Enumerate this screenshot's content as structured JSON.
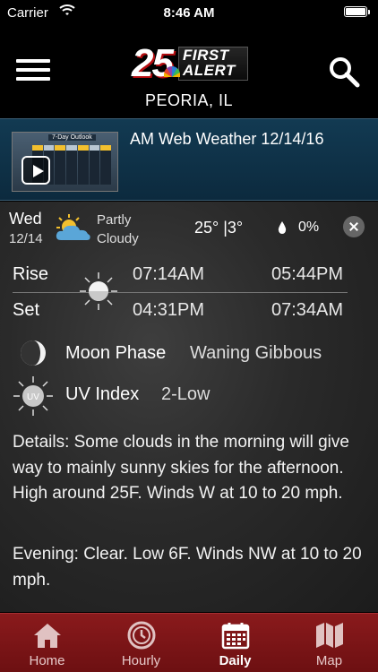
{
  "status_bar": {
    "carrier": "Carrier",
    "time": "8:46 AM"
  },
  "header": {
    "logo": {
      "number": "25",
      "line1": "FIRST",
      "line2": "ALERT"
    },
    "location": "PEORIA, IL"
  },
  "video": {
    "title": "AM Web Weather 12/14/16",
    "thumbnail_caption": "7-Day Outlook"
  },
  "day": {
    "name": "Wed",
    "date": "12/14",
    "condition_line1": "Partly",
    "condition_line2": "Cloudy",
    "temps": "25° |3°",
    "precip": "0%",
    "icon": "partly-cloudy-icon"
  },
  "sun_moon": {
    "rise_label": "Rise",
    "set_label": "Set",
    "sunrise": "07:14AM",
    "sunset": "04:31PM",
    "moonrise": "05:44PM",
    "moonset": "07:34AM"
  },
  "moon_phase": {
    "label": "Moon Phase",
    "value": "Waning Gibbous"
  },
  "uv": {
    "label": "UV Index",
    "value": "2-Low",
    "icon_text": "UV"
  },
  "details": "Details: Some clouds in the morning will give way to mainly sunny skies for the afternoon. High around 25F. Winds W at 10 to 20 mph.",
  "evening": "Evening: Clear. Low 6F. Winds NW at 10 to 20 mph.",
  "tabs": [
    {
      "label": "Home",
      "icon": "home-icon",
      "active": false
    },
    {
      "label": "Hourly",
      "icon": "clock-icon",
      "active": false
    },
    {
      "label": "Daily",
      "icon": "calendar-icon",
      "active": true
    },
    {
      "label": "Map",
      "icon": "map-icon",
      "active": false
    }
  ],
  "colors": {
    "tab_bar": "#7a1416",
    "video_bar": "#123a52",
    "accent_sun": "#f3c02e"
  }
}
